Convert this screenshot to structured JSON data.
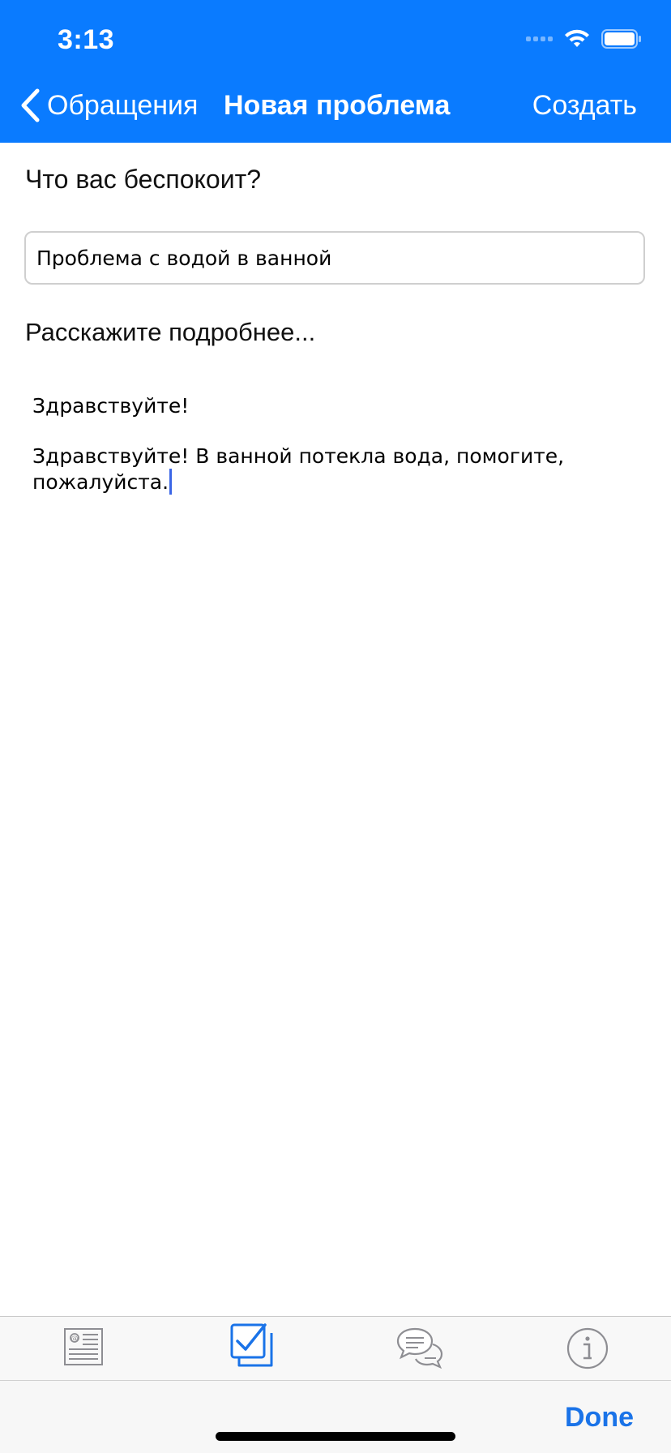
{
  "status_bar": {
    "time": "3:13"
  },
  "nav": {
    "back_label": "Обращения",
    "title": "Новая проблема",
    "create_label": "Создать"
  },
  "form": {
    "question_label": "Что вас беспокоит?",
    "subject_value": "Проблема с водой в ванной",
    "details_label": "Расскажите подробнее...",
    "details_lines": [
      "Здравствуйте!",
      "",
      "Здравствуйте! В ванной потекла вода, помогите,",
      "пожалуйста."
    ]
  },
  "tabbar": {
    "icons": [
      "newsletter-icon",
      "checkbox-icon",
      "chat-bubbles-icon",
      "info-icon"
    ],
    "active_index": 1,
    "active_color": "#1a73e8",
    "inactive_color": "#8e8e93"
  },
  "keyboard_accessory": {
    "done_label": "Done"
  },
  "colors": {
    "header_bg": "#0a7bff",
    "accent": "#1a73e8",
    "cursor": "#3b66e6"
  }
}
